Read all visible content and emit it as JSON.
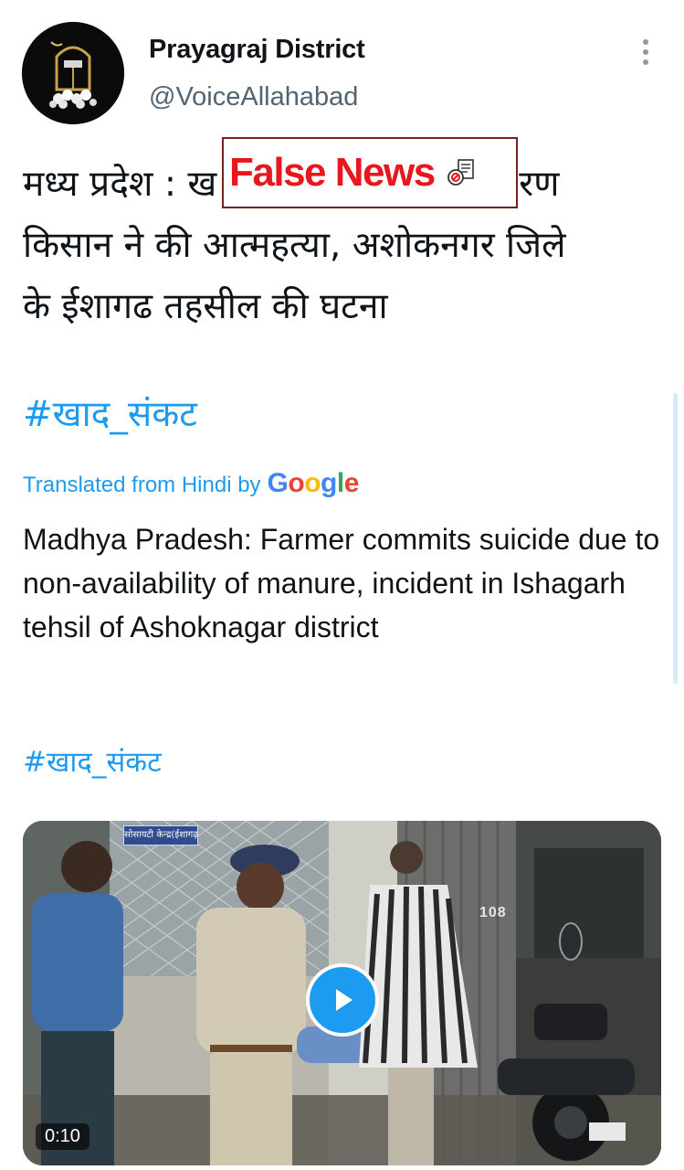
{
  "tweet": {
    "author": {
      "display_name": "Prayagraj District",
      "handle": "@VoiceAllahabad"
    },
    "text_lines": [
      "मध्य प्रदेश : ख",
      "किसान ने की आत्महत्या, अशोकनगर जिले",
      "के ईशागढ तहसील की घटना"
    ],
    "text_line1_tail": "रण",
    "hashtag": "#खाद_संकट",
    "translated_label": "Translated from Hindi by",
    "translator": "Google",
    "translation": "Madhya Pradesh: Farmer commits suicide due to non-availability of manure, incident in Ishagarh tehsil of Ashoknagar district",
    "hashtag_2": "#खाद_संकट"
  },
  "stamp": {
    "label": "False News"
  },
  "video": {
    "duration": "0:10",
    "sign_text": "सोसायटी केन्द्र(ईशागढ़)",
    "door_number": "108"
  },
  "colors": {
    "link": "#1d9bf0",
    "stamp_red": "#e8171d",
    "text": "#0f1419",
    "secondary": "#536471"
  },
  "icons": {
    "more": "more-vertical-icon",
    "play": "play-icon",
    "stamp": "fact-check-icon"
  }
}
